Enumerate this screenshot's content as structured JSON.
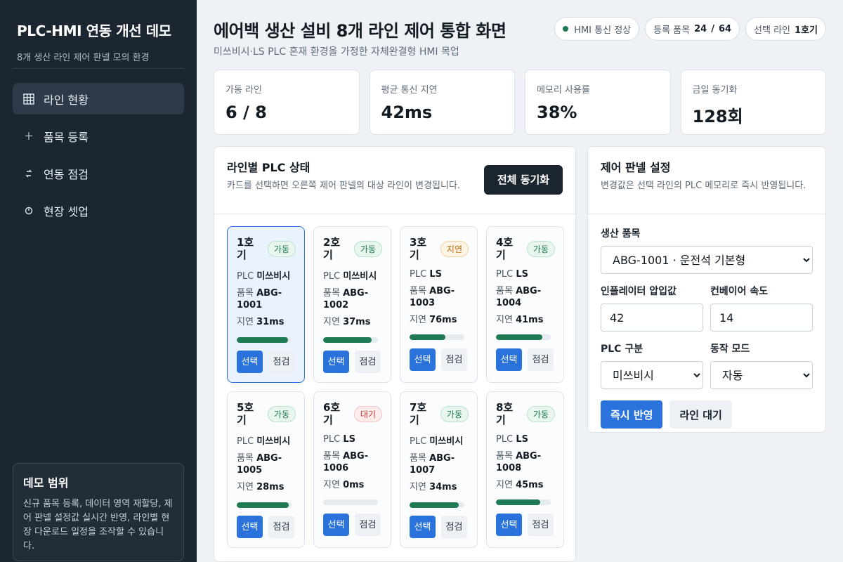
{
  "sidebar": {
    "title": "PLC-HMI 연동 개선 데모",
    "subtitle": "8개 생산 라인 제어 판넬 모의 환경",
    "nav": [
      {
        "label": "라인 현황",
        "icon": "grid-icon"
      },
      {
        "label": "품목 등록",
        "icon": "plus-icon"
      },
      {
        "label": "연동 점검",
        "icon": "link-icon"
      },
      {
        "label": "현장 셋업",
        "icon": "gauge-icon"
      }
    ],
    "scope": {
      "title": "데모 범위",
      "text": "신규 품목 등록, 데이터 영역 재할당, 제어 판넬 설정값 실시간 반영, 라인별 현장 다운로드 일정을 조작할 수 있습니다."
    }
  },
  "header": {
    "title": "에어백 생산 설비 8개 라인 제어 통합 화면",
    "subtitle": "미쓰비시·LS PLC 혼재 환경을 가정한 자체완결형 HMI 목업",
    "chips": {
      "status": "HMI 통신 정상",
      "items_label": "등록 품목",
      "items_current": "24",
      "items_sep": "/",
      "items_total": "64",
      "line_label": "선택 라인",
      "line_value": "1호기"
    }
  },
  "stats": [
    {
      "label": "가동 라인",
      "value": "6 / 8"
    },
    {
      "label": "평균 통신 지연",
      "value": "42ms"
    },
    {
      "label": "메모리 사용률",
      "value": "38%"
    },
    {
      "label": "금일 동기화",
      "value": "128회"
    }
  ],
  "lines_panel": {
    "title": "라인별 PLC 상태",
    "desc": "카드를 선택하면 오른쪽 제어 판넬의 대상 라인이 변경됩니다.",
    "sync_label": "전체 동기화",
    "plc_label": "PLC",
    "item_label": "품목",
    "delay_label": "지연",
    "select_label": "선택",
    "check_label": "점검",
    "cards": [
      {
        "name": "1호기",
        "status": "가동",
        "plc": "미쓰비시",
        "item": "ABG-1001",
        "delay": "31ms",
        "progress": 0.93
      },
      {
        "name": "2호기",
        "status": "가동",
        "plc": "미쓰비시",
        "item": "ABG-1002",
        "delay": "37ms",
        "progress": 0.88
      },
      {
        "name": "3호기",
        "status": "지연",
        "plc": "LS",
        "item": "ABG-1003",
        "delay": "76ms",
        "progress": 0.65
      },
      {
        "name": "4호기",
        "status": "가동",
        "plc": "LS",
        "item": "ABG-1004",
        "delay": "41ms",
        "progress": 0.85
      },
      {
        "name": "5호기",
        "status": "가동",
        "plc": "미쓰비시",
        "item": "ABG-1005",
        "delay": "28ms",
        "progress": 0.95
      },
      {
        "name": "6호기",
        "status": "대기",
        "plc": "LS",
        "item": "ABG-1006",
        "delay": "0ms",
        "progress": 0
      },
      {
        "name": "7호기",
        "status": "가동",
        "plc": "미쓰비시",
        "item": "ABG-1007",
        "delay": "34ms",
        "progress": 0.9
      },
      {
        "name": "8호기",
        "status": "가동",
        "plc": "LS",
        "item": "ABG-1008",
        "delay": "45ms",
        "progress": 0.81
      }
    ]
  },
  "control_panel": {
    "title": "제어 판넬 설정",
    "desc": "변경값은 선택 라인의 PLC 메모리로 즉시 반영됩니다.",
    "product_label": "생산 품목",
    "product_value": "ABG-1001 · 운전석 기본형",
    "pressure_label": "인플레이터 압입값",
    "pressure_value": "42",
    "speed_label": "컨베이어 속도",
    "speed_value": "14",
    "plc_type_label": "PLC 구분",
    "plc_type_value": "미쓰비시",
    "mode_label": "동작 모드",
    "mode_value": "자동",
    "apply_label": "즉시 반영",
    "standby_label": "라인 대기"
  }
}
